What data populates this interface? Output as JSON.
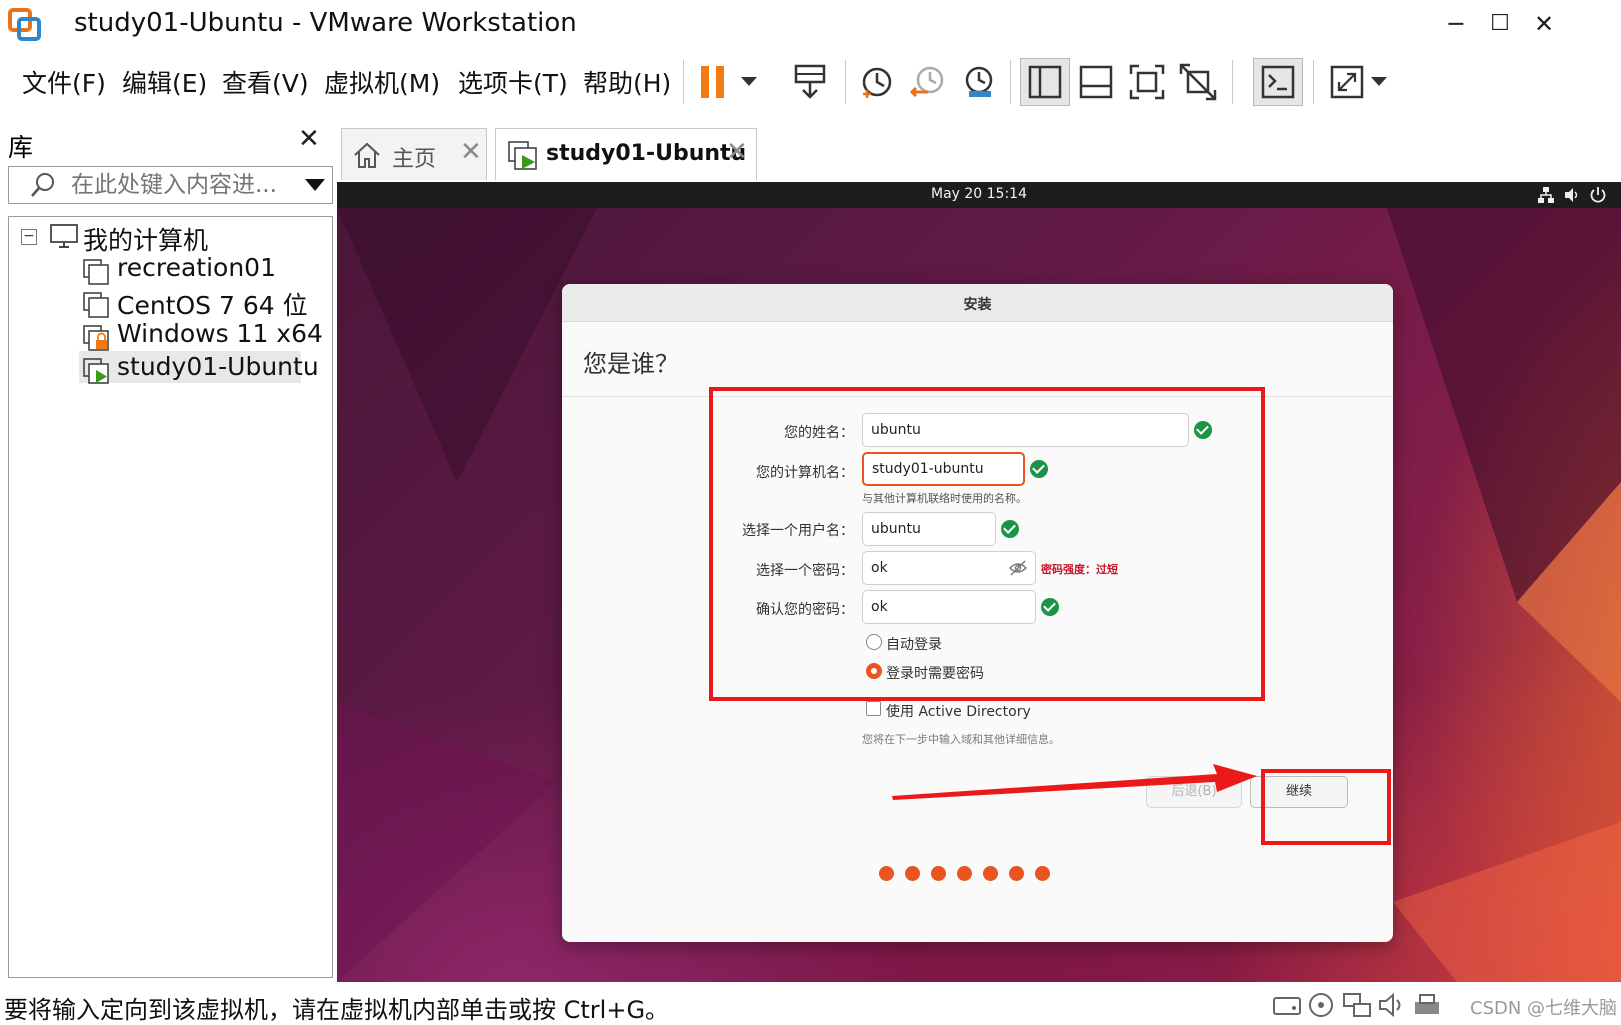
{
  "window": {
    "title": "study01-Ubuntu - VMware Workstation",
    "minimize": "─",
    "maximize": "☐",
    "close": "✕"
  },
  "menu": [
    "文件(F)",
    "编辑(E)",
    "查看(V)",
    "虚拟机(M)",
    "选项卡(T)",
    "帮助(H)"
  ],
  "toolbar": {
    "icons": [
      "pause-icon",
      "dropdown-arrow-icon",
      "send-ctrl-alt-del-icon",
      "snapshot-take-icon",
      "snapshot-revert-icon",
      "snapshot-manager-icon",
      "sidebar-view-icon",
      "thumbnail-view-icon",
      "fullscreen-icon",
      "unity-icon",
      "console-icon",
      "stretch-icon"
    ]
  },
  "library": {
    "title": "库",
    "close": "✕",
    "search_placeholder": "在此处键入内容进...",
    "tree_root": "我的计算机",
    "vms": [
      "recreation01",
      "CentOS 7 64 位",
      "Windows 11 x64",
      "study01-Ubuntu"
    ],
    "selected_vm": "study01-Ubuntu"
  },
  "tabs": [
    {
      "label": "主页",
      "close": "✕",
      "active": false
    },
    {
      "label": "study01-Ubuntu",
      "close": "✕",
      "active": true
    }
  ],
  "vm": {
    "clock": "May 20  15:14",
    "installer": {
      "title": "安装",
      "heading": "您是谁？",
      "fields": {
        "name_label": "您的姓名：",
        "name_value": "ubuntu",
        "computer_label": "您的计算机名：",
        "computer_value": "study01-ubuntu",
        "computer_hint": "与其他计算机联络时使用的名称。",
        "username_label": "选择一个用户名：",
        "username_value": "ubuntu",
        "password_label": "选择一个密码：",
        "password_value": "ok",
        "password_strength": "密码强度：过短",
        "confirm_label": "确认您的密码：",
        "confirm_value": "ok"
      },
      "options": {
        "auto_login": "自动登录",
        "require_password": "登录时需要密码",
        "active_directory": "使用 Active Directory",
        "active_directory_hint": "您将在下一步中输入域和其他详细信息。"
      },
      "buttons": {
        "back": "后退(B)",
        "continue": "继续"
      },
      "steps_total": 7
    }
  },
  "statusbar": {
    "message": "要将输入定向到该虚拟机，请在虚拟机内部单击或按 Ctrl+G。",
    "watermark": "CSDN @七维大脑"
  },
  "colors": {
    "accent": "#e95420",
    "ok_green": "#1a9447",
    "annotation_red": "#ea1a1a",
    "toolbar_orange": "#f07b14"
  }
}
